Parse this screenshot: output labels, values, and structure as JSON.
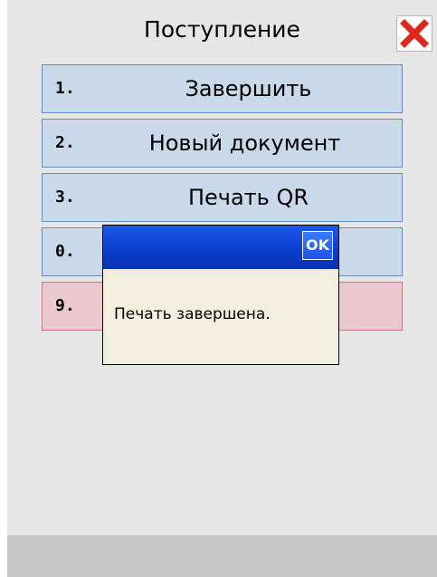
{
  "header": {
    "title": "Поступление",
    "close_icon": "close-icon",
    "close_icon_color": "#e3241b"
  },
  "menu": {
    "items": [
      {
        "number": "1.",
        "label": "Завершить"
      },
      {
        "number": "2.",
        "label": "Новый документ"
      },
      {
        "number": "3.",
        "label": "Печать QR"
      },
      {
        "number": "0.",
        "label": ""
      },
      {
        "number": "9.",
        "label": ""
      }
    ],
    "colors": {
      "normal_fill": "#c9d9ea",
      "normal_border": "#6a8cb8",
      "danger_fill": "#ebc8cc",
      "danger_border": "#c47a82"
    }
  },
  "dialog": {
    "ok_label": "OK",
    "message": "Печать завершена.",
    "titlebar_color": "#0a3fd0",
    "body_color": "#f3efde"
  },
  "screen": {
    "background": "#e6e6e6",
    "bottom_bar": "#c8c8c8"
  }
}
